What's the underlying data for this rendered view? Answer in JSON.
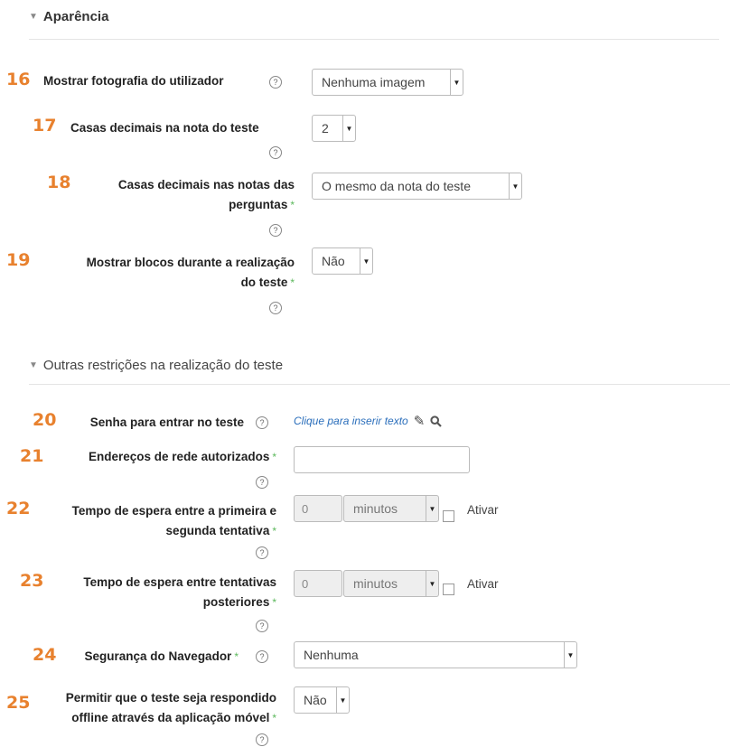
{
  "sections": {
    "appearance": "Aparência",
    "restrictions": "Outras restrições na realização do teste"
  },
  "fields": [
    {
      "num": "16",
      "label": "Mostrar fotografia do utilizador",
      "value": "Nenhuma imagem"
    },
    {
      "num": "17",
      "label": "Casas decimais na nota do teste",
      "value": "2"
    },
    {
      "num": "18",
      "label_line1": "Casas decimais nas notas das",
      "label_line2": "perguntas",
      "value": "O mesmo da nota do teste"
    },
    {
      "num": "19",
      "label_line1": "Mostrar blocos durante a realização",
      "label_line2": "do teste",
      "value": "Não"
    },
    {
      "num": "20",
      "label": "Senha para entrar no teste",
      "link": "Clique para inserir texto"
    },
    {
      "num": "21",
      "label": "Endereços de rede autorizados",
      "value": ""
    },
    {
      "num": "22",
      "label_line1": "Tempo de espera entre a primeira e",
      "label_line2": "segunda tentativa",
      "amount": "0",
      "unit": "minutos",
      "enable": "Ativar"
    },
    {
      "num": "23",
      "label_line1": "Tempo de espera entre tentativas",
      "label_line2": "posteriores",
      "amount": "0",
      "unit": "minutos",
      "enable": "Ativar"
    },
    {
      "num": "24",
      "label": "Segurança do Navegador",
      "value": "Nenhuma"
    },
    {
      "num": "25",
      "label_line1": "Permitir que o teste seja respondido",
      "label_line2": "offline através da aplicação móvel",
      "value": "Não"
    }
  ],
  "icons": {
    "help": "?",
    "required": "*",
    "collapse": "▼",
    "dropdown": "▼",
    "pencil": "✎",
    "search": "search-icon"
  }
}
